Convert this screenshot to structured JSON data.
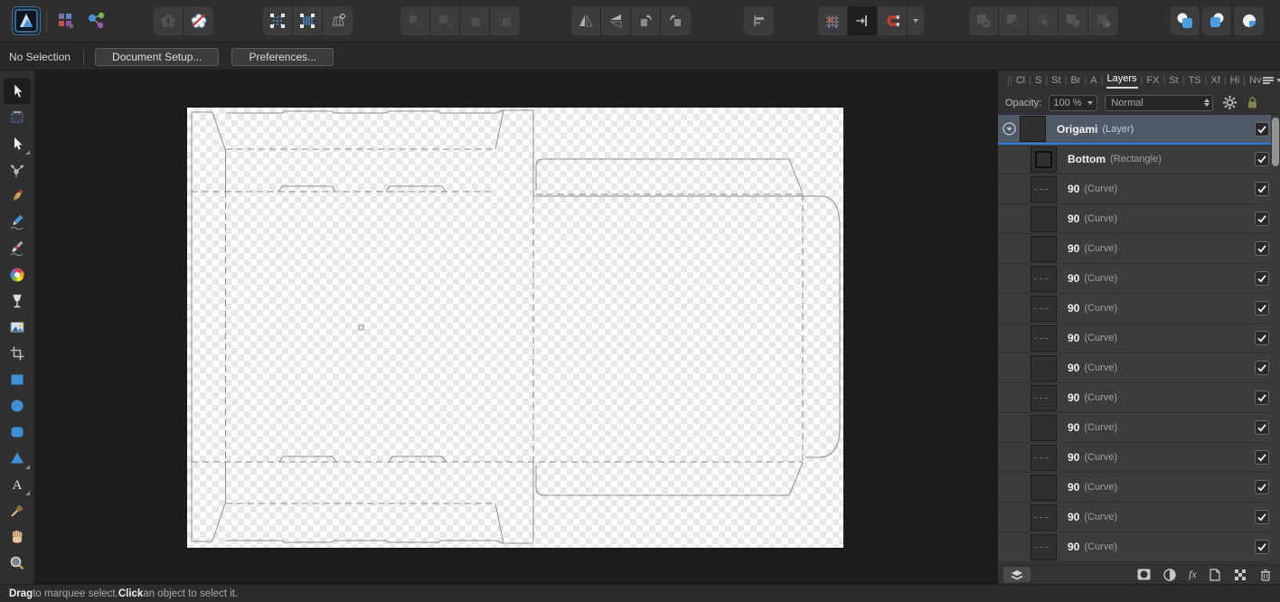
{
  "colors": {
    "accent_blue": "#2d7fe0",
    "selection_row": "#4f5a66",
    "tool_blue": "#3f8fd6",
    "magnet_red": "#c23b2e",
    "checker_light": "#ffffff",
    "checker_dark": "#e8e8e8"
  },
  "top_toolbar": {
    "personas": [
      "designer-persona",
      "pixel-persona",
      "export-persona"
    ],
    "icon_groups": [
      [
        "defaults-sync-icon",
        "defaults-revert-icon"
      ],
      [
        "marquee-dots-icon",
        "marquee-lines-icon",
        "transform-cage-icon"
      ],
      [
        "move-to-front-icon",
        "move-forward-icon",
        "move-backward-icon",
        "move-to-back-icon"
      ],
      [
        "flip-horizontal-icon",
        "flip-vertical-icon",
        "rotate-ccw-icon",
        "rotate-cw-icon"
      ],
      [
        "alignment-icon"
      ],
      [
        "snap-grid-icon",
        "pixel-align-icon",
        "snapping-magnet-icon",
        "snapping-caret"
      ],
      [
        "boolean-add-icon",
        "boolean-subtract-icon",
        "boolean-intersect-icon",
        "boolean-divide-icon",
        "boolean-combine-icon"
      ],
      [
        "insert-behind-icon",
        "insert-inside-icon",
        "insert-on-top-icon"
      ]
    ]
  },
  "context_bar": {
    "status_label": "No Selection",
    "document_setup_button": "Document Setup...",
    "preferences_button": "Preferences..."
  },
  "tools_panel": {
    "tools": [
      "move-tool",
      "artboard-tool",
      "node-tool",
      "point-transform-tool",
      "pen-tool",
      "pencil-tool",
      "vector-brush-tool",
      "color-wheel-tool",
      "transparency-tool",
      "place-image-tool",
      "crop-tool",
      "rectangle-tool",
      "ellipse-tool",
      "rounded-rectangle-tool",
      "triangle-tool",
      "text-tool",
      "eyedropper-tool",
      "hand-tool",
      "zoom-tool"
    ],
    "selected_tool": "move-tool"
  },
  "canvas": {
    "content": "origami box packaging dieline on transparent checkerboard"
  },
  "layers_panel": {
    "leading_divider": "||",
    "tabs": [
      "Cl",
      "S",
      "St",
      "Br",
      "A",
      "Layers",
      "FX",
      "St",
      "TS",
      "Xf",
      "Hi",
      "Nv"
    ],
    "active_tab": "Layers",
    "opacity_label": "Opacity:",
    "opacity_value": "100 %",
    "blend_mode": "Normal",
    "footer": {
      "fx_label": "fx"
    },
    "layers": [
      {
        "name": "Origami",
        "type": "(Layer)",
        "selected": true,
        "expandable": true,
        "checked": true,
        "indent": 0,
        "thumb": "empty"
      },
      {
        "name": "Bottom",
        "type": "(Rectangle)",
        "selected": false,
        "expandable": false,
        "checked": true,
        "indent": 1,
        "thumb": "rectangle"
      },
      {
        "name": "90",
        "type": "(Curve)",
        "selected": false,
        "expandable": false,
        "checked": true,
        "indent": 1,
        "thumb": "curve"
      },
      {
        "name": "90",
        "type": "(Curve)",
        "selected": false,
        "expandable": false,
        "checked": true,
        "indent": 1,
        "thumb": "empty"
      },
      {
        "name": "90",
        "type": "(Curve)",
        "selected": false,
        "expandable": false,
        "checked": true,
        "indent": 1,
        "thumb": "empty"
      },
      {
        "name": "90",
        "type": "(Curve)",
        "selected": false,
        "expandable": false,
        "checked": true,
        "indent": 1,
        "thumb": "curve"
      },
      {
        "name": "90",
        "type": "(Curve)",
        "selected": false,
        "expandable": false,
        "checked": true,
        "indent": 1,
        "thumb": "curve"
      },
      {
        "name": "90",
        "type": "(Curve)",
        "selected": false,
        "expandable": false,
        "checked": true,
        "indent": 1,
        "thumb": "curve"
      },
      {
        "name": "90",
        "type": "(Curve)",
        "selected": false,
        "expandable": false,
        "checked": true,
        "indent": 1,
        "thumb": "empty"
      },
      {
        "name": "90",
        "type": "(Curve)",
        "selected": false,
        "expandable": false,
        "checked": true,
        "indent": 1,
        "thumb": "curve"
      },
      {
        "name": "90",
        "type": "(Curve)",
        "selected": false,
        "expandable": false,
        "checked": true,
        "indent": 1,
        "thumb": "empty"
      },
      {
        "name": "90",
        "type": "(Curve)",
        "selected": false,
        "expandable": false,
        "checked": true,
        "indent": 1,
        "thumb": "curve"
      },
      {
        "name": "90",
        "type": "(Curve)",
        "selected": false,
        "expandable": false,
        "checked": true,
        "indent": 1,
        "thumb": "empty"
      },
      {
        "name": "90",
        "type": "(Curve)",
        "selected": false,
        "expandable": false,
        "checked": true,
        "indent": 1,
        "thumb": "curve"
      },
      {
        "name": "90",
        "type": "(Curve)",
        "selected": false,
        "expandable": false,
        "checked": true,
        "indent": 1,
        "thumb": "curve"
      }
    ]
  },
  "status_bar": {
    "segments": [
      {
        "text": "Drag",
        "bold": true
      },
      {
        "text": " to marquee select. ",
        "bold": false
      },
      {
        "text": "Click",
        "bold": true
      },
      {
        "text": " an object to select it.",
        "bold": false
      }
    ]
  }
}
